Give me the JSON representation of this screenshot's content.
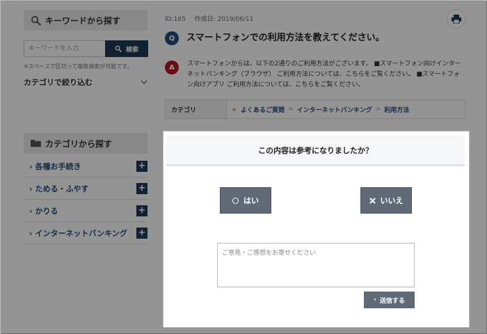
{
  "sidebar": {
    "keyword_heading": "キーワードから探す",
    "search_placeholder": "キーワードを入力",
    "search_button": "検索",
    "search_note": "※スペースで区切って複数検索が可能です。",
    "narrow_label": "カテゴリで絞り込む",
    "category_heading": "カテゴリから探す",
    "categories": [
      {
        "label": "各種お手続き"
      },
      {
        "label": "ためる・ふやす"
      },
      {
        "label": "かりる"
      },
      {
        "label": "インターネットバンキング"
      }
    ]
  },
  "article": {
    "id_label": "ID:165",
    "created_label": "作成日: 2019/06/11",
    "q_badge": "Q",
    "a_badge": "A",
    "question": "スマートフォンでの利用方法を教えてください。",
    "answer": "スマートフォンからは、以下の2通りのご利用方法がございます。 ■スマートフォン向けインターネットバンキング（ブラウザ） ご利用方法については、こちらをご覧ください。 ■スマートフォン向けアプリ ご利用方法については、こちらをご覧ください。",
    "category_label": "カテゴリ",
    "breadcrumb": [
      "よくあるご質問",
      "インターネットバンキング",
      "利用方法"
    ],
    "breadcrumb_sep": ">"
  },
  "feedback": {
    "title": "この内容は参考になりましたか？",
    "yes_label": "はい",
    "no_label": "いいえ",
    "comment_placeholder": "ご意見・ご感想をお寄せください",
    "send_label": "送信する"
  },
  "colors": {
    "navy": "#1f3a55",
    "link": "#2a4e7c",
    "q_badge": "#1f4f80",
    "a_badge": "#b5171d",
    "button_gray": "#5f6a76"
  }
}
